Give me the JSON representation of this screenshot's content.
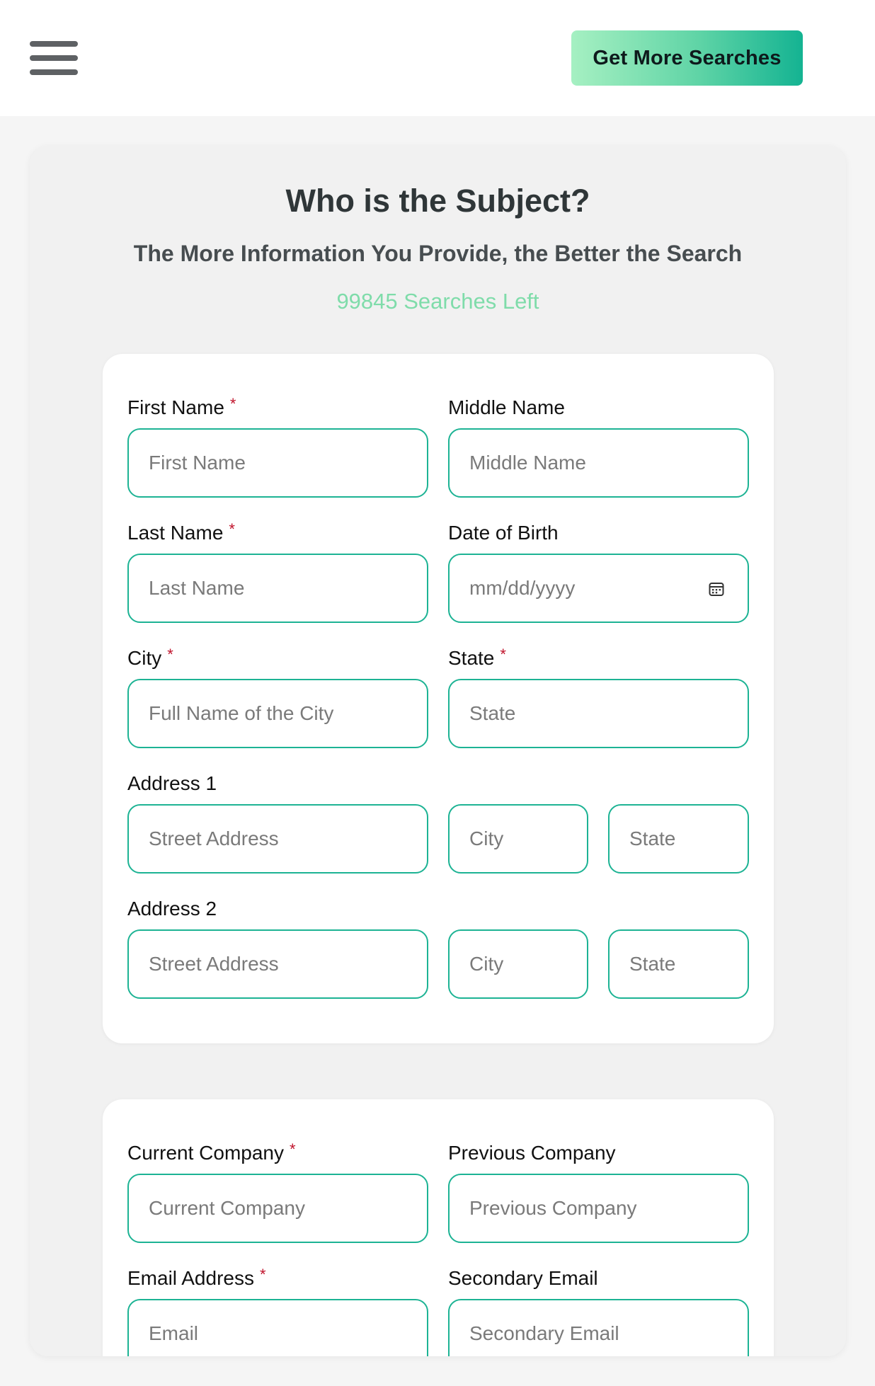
{
  "header": {
    "cta_label": "Get More Searches"
  },
  "page": {
    "title": "Who is the Subject?",
    "subtitle": "The More Information You Provide, the Better the Search",
    "searches_left": "99845 Searches Left"
  },
  "form": {
    "first_name": {
      "label": "First Name",
      "required_mark": "*",
      "placeholder": "First Name"
    },
    "middle_name": {
      "label": "Middle Name",
      "placeholder": "Middle Name"
    },
    "last_name": {
      "label": "Last Name",
      "required_mark": "*",
      "placeholder": "Last Name"
    },
    "dob": {
      "label": "Date of Birth",
      "placeholder": "mm/dd/yyyy"
    },
    "city": {
      "label": "City",
      "required_mark": "*",
      "placeholder": "Full Name of the City"
    },
    "state": {
      "label": "State",
      "required_mark": "*",
      "placeholder": "State"
    },
    "address1": {
      "label": "Address 1",
      "street_placeholder": "Street Address",
      "city_placeholder": "City",
      "state_placeholder": "State"
    },
    "address2": {
      "label": "Address 2",
      "street_placeholder": "Street Address",
      "city_placeholder": "City",
      "state_placeholder": "State"
    },
    "current_company": {
      "label": "Current Company",
      "required_mark": "*",
      "placeholder": "Current Company"
    },
    "previous_company": {
      "label": "Previous Company",
      "placeholder": "Previous Company"
    },
    "email": {
      "label": "Email Address",
      "required_mark": "*",
      "placeholder": "Email"
    },
    "secondary_email": {
      "label": "Secondary Email",
      "placeholder": "Secondary Email"
    }
  },
  "colors": {
    "accent": "#1db394",
    "counter": "#7fdcaa",
    "required": "#c0132b"
  }
}
